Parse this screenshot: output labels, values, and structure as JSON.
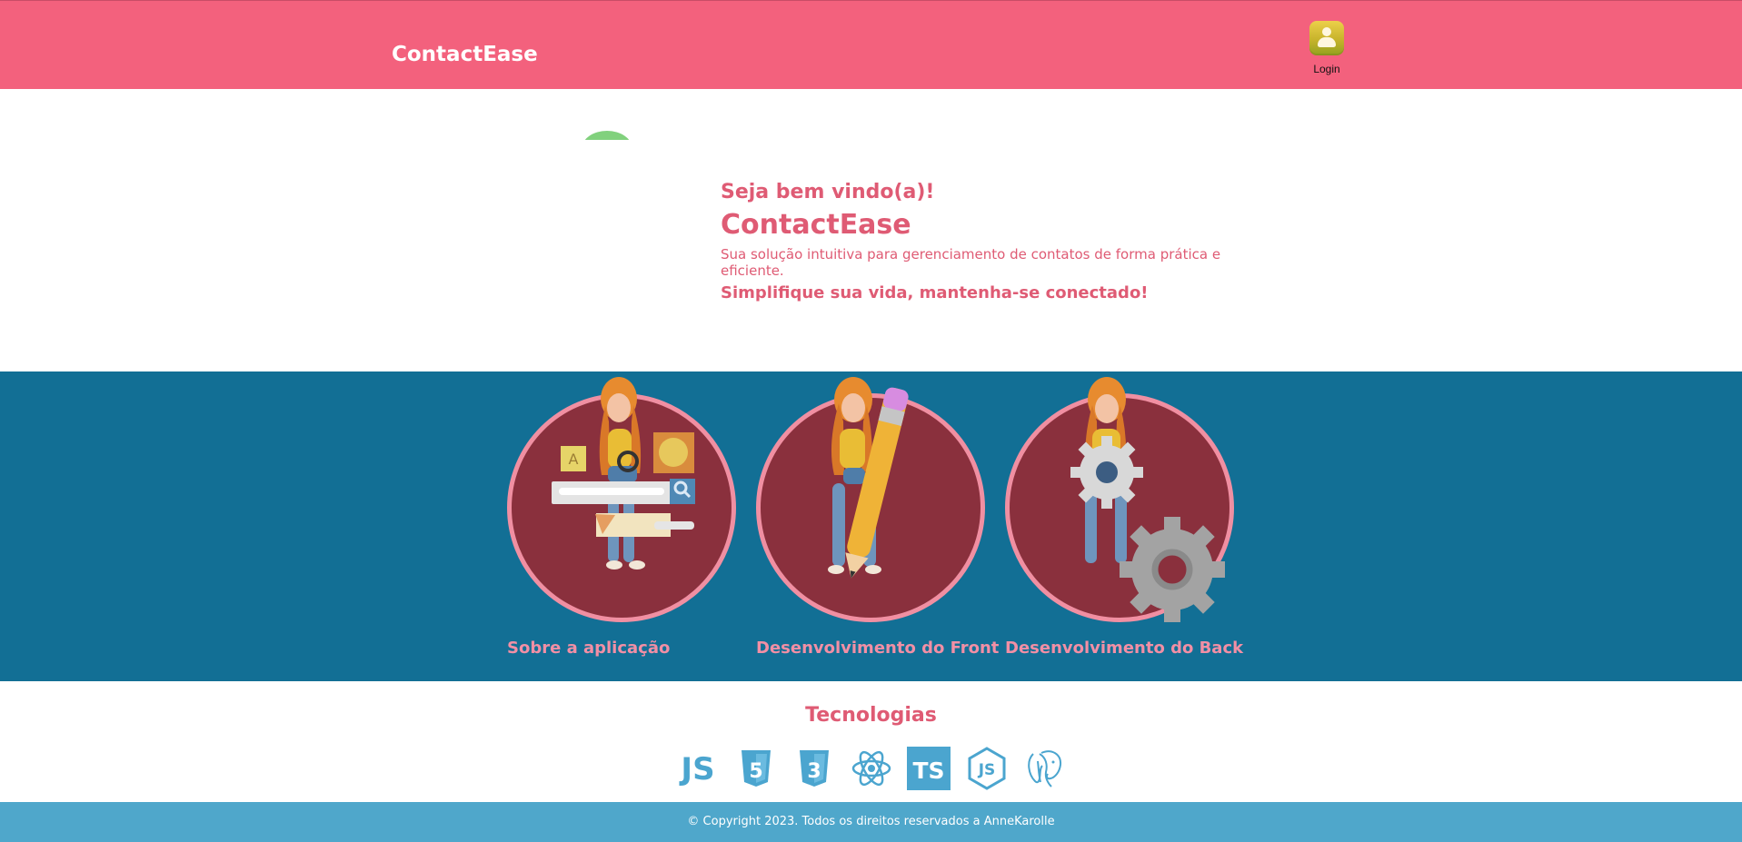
{
  "header": {
    "brand": "ContactEase",
    "login_label": "Login",
    "login_icon": "user-icon"
  },
  "hero": {
    "welcome": "Seja bem vindo(a)!",
    "title": "ContactEase",
    "description": "Sua solução intuitiva para gerenciamento de contatos de forma prática e eficiente.",
    "tagline": "Simplifique sua vida, mantenha-se conectado!"
  },
  "cards": [
    {
      "label": "Sobre a aplicação",
      "illustration": "girl-with-search-ui-illustration"
    },
    {
      "label": "Desenvolvimento do Front",
      "illustration": "girl-with-pencil-illustration"
    },
    {
      "label": "Desenvolvimento do Back",
      "illustration": "girl-with-gears-illustration"
    }
  ],
  "technologies": {
    "title": "Tecnologias",
    "icons": [
      "javascript-icon",
      "html5-icon",
      "css3-icon",
      "react-icon",
      "typescript-icon",
      "nodejs-icon",
      "postgresql-icon"
    ],
    "texts": {
      "javascript": "JS",
      "html": "5",
      "css": "3",
      "typescript": "TS",
      "node": "JS"
    }
  },
  "footer": {
    "text": "© Copyright 2023. Todos os direitos reservados a AnneKarolle"
  },
  "colors": {
    "header_bg": "#f3617d",
    "accent_pink": "#df5b74",
    "card_band_bg": "#126f95",
    "card_circle_bg": "#8a303d",
    "card_circle_border": "#f08fa2",
    "tech_icon": "#4ba5cf",
    "footer_bg": "#4fa7cb"
  }
}
